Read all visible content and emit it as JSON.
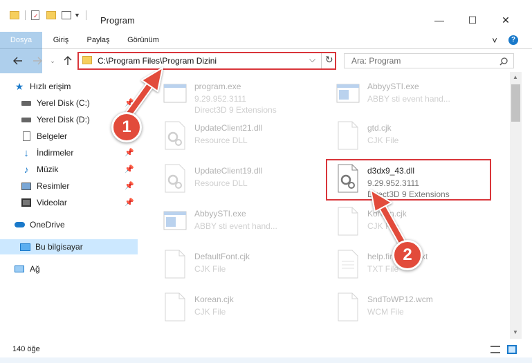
{
  "window": {
    "title": "Program",
    "minimize": "—",
    "maximize": "☐",
    "close": "✕"
  },
  "ribbon": {
    "tabs": [
      "Dosya",
      "Giriş",
      "Paylaş",
      "Görünüm"
    ],
    "expand": "˅",
    "help": "?"
  },
  "address": {
    "path": "C:\\Program Files\\Program Dizini",
    "dropdown": "⌵",
    "refresh": "↻"
  },
  "search": {
    "placeholder": "Ara: Program"
  },
  "nav": {
    "items": [
      {
        "label": "Hızlı erişim",
        "icon": "star-icon"
      },
      {
        "label": "Yerel Disk (C:)",
        "icon": "drive-icon",
        "pinned": true
      },
      {
        "label": "Yerel Disk (D:)",
        "icon": "drive-icon",
        "pinned": true
      },
      {
        "label": "Belgeler",
        "icon": "document-icon",
        "pinned": true
      },
      {
        "label": "İndirmeler",
        "icon": "download-icon",
        "pinned": true
      },
      {
        "label": "Müzik",
        "icon": "music-icon",
        "pinned": true
      },
      {
        "label": "Resimler",
        "icon": "pictures-icon",
        "pinned": true
      },
      {
        "label": "Videolar",
        "icon": "video-icon",
        "pinned": true
      },
      {
        "label": "OneDrive",
        "icon": "cloud-icon"
      },
      {
        "label": "Bu bilgisayar",
        "icon": "computer-icon",
        "selected": true
      },
      {
        "label": "Ağ",
        "icon": "network-icon"
      }
    ]
  },
  "files": [
    {
      "name": "program.exe",
      "line2": "9.29.952.3111",
      "line3": "Direct3D 9 Extensions",
      "type": "exe"
    },
    {
      "name": "AbbyySTI.exe",
      "line2": "ABBY sti event hand...",
      "line3": "",
      "type": "exe"
    },
    {
      "name": "UpdateClient21.dll",
      "line2": "Resource DLL",
      "line3": "",
      "type": "dll"
    },
    {
      "name": "gtd.cjk",
      "line2": "CJK File",
      "line3": "",
      "type": "doc"
    },
    {
      "name": "UpdateClient19.dll",
      "line2": "Resource DLL",
      "line3": "",
      "type": "dll"
    },
    {
      "name": "d3dx9_43.dll",
      "line2": "9.29.952.3111",
      "line3": "Direct3D 9 Extensions",
      "type": "dll",
      "highlighted": true
    },
    {
      "name": "AbbyySTI.exe",
      "line2": "ABBY sti event hand...",
      "line3": "",
      "type": "exe"
    },
    {
      "name": "Korean.cjk",
      "line2": "CJK File",
      "line3": "",
      "type": "doc"
    },
    {
      "name": "DefaultFont.cjk",
      "line2": "CJK File",
      "line3": "",
      "type": "doc"
    },
    {
      "name": "help.first.user.txt",
      "line2": "TXT File",
      "line3": "",
      "type": "doc"
    },
    {
      "name": "Korean.cjk",
      "line2": "CJK File",
      "line3": "",
      "type": "doc"
    },
    {
      "name": "SndToWP12.wcm",
      "line2": "WCM File",
      "line3": "",
      "type": "doc"
    }
  ],
  "status": {
    "count": "140 öğe"
  },
  "annotations": {
    "step1": "1",
    "step2": "2",
    "color": "#e24b3b"
  },
  "colors": {
    "accent": "#1979ca",
    "highlight": "#d9353a",
    "selection": "#cce8ff"
  }
}
